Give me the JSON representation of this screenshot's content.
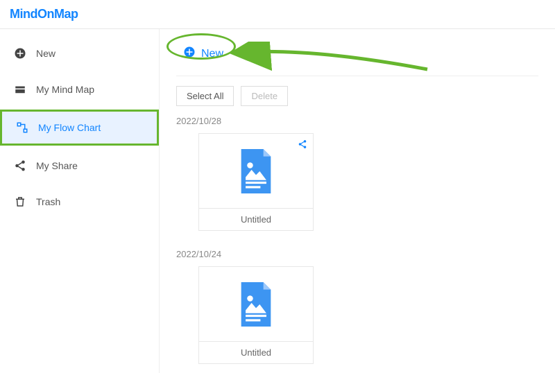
{
  "brand": "MindOnMap",
  "sidebar": {
    "items": [
      {
        "label": "New"
      },
      {
        "label": "My Mind Map"
      },
      {
        "label": "My Flow Chart"
      },
      {
        "label": "My Share"
      },
      {
        "label": "Trash"
      }
    ]
  },
  "main": {
    "new_label": "New",
    "select_all_label": "Select All",
    "delete_label": "Delete",
    "groups": [
      {
        "date": "2022/10/28",
        "items": [
          {
            "title": "Untitled",
            "shared": true
          }
        ]
      },
      {
        "date": "2022/10/24",
        "items": [
          {
            "title": "Untitled",
            "shared": false
          }
        ]
      }
    ]
  }
}
